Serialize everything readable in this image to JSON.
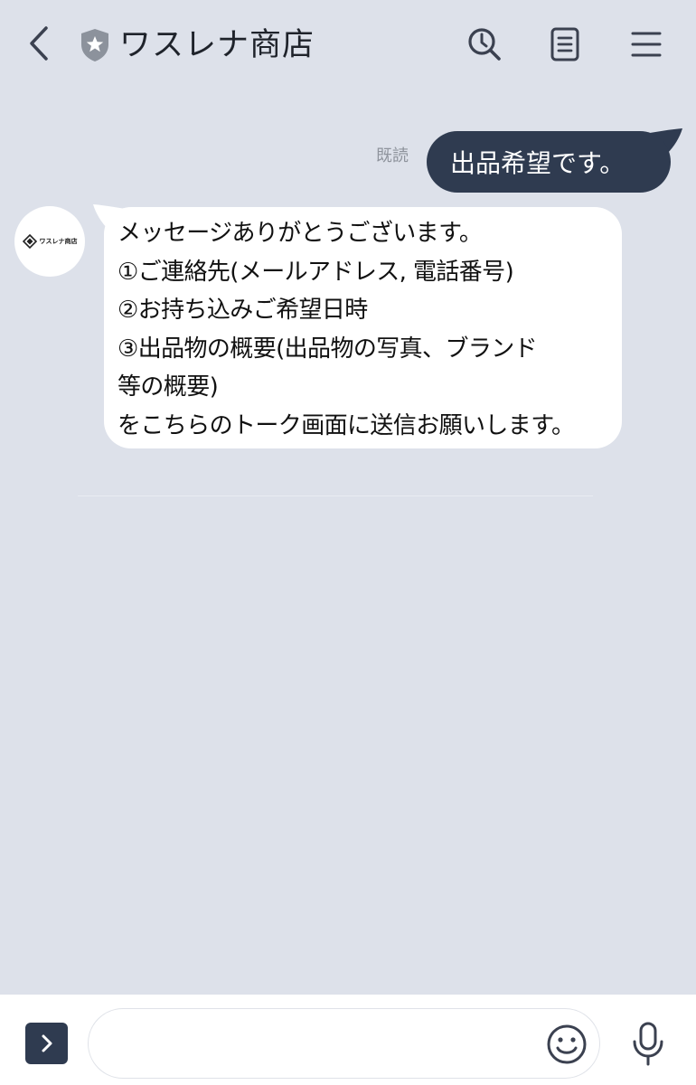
{
  "header": {
    "title": "ワスレナ商店",
    "icons": {
      "back": "chevron-left-icon",
      "verified": "shield-star-icon",
      "search": "search-icon",
      "notes": "notes-icon",
      "menu": "menu-icon"
    }
  },
  "chat": {
    "read_label": "既読",
    "outgoing": {
      "text": "出品希望です。"
    },
    "incoming": {
      "avatar_text": "ワスレナ商店",
      "lines": [
        "メッセージありがとうございます。",
        "①ご連絡先(メールアドレス, 電話番号)",
        "②お持ち込みご希望日時",
        "③出品物の概要(出品物の写真、ブランド",
        "等の概要)",
        "をこちらのトーク画面に送信お願いします。"
      ]
    }
  },
  "input_bar": {
    "value": "",
    "placeholder": "",
    "icons": {
      "expand": "chevron-right-icon",
      "emoji": "smiley-icon",
      "mic": "microphone-icon"
    }
  },
  "colors": {
    "background": "#dde1ea",
    "outgoing_bubble": "#2f3b50",
    "incoming_bubble": "#ffffff",
    "read_label": "#8e939c",
    "icon": "#3b4150"
  }
}
